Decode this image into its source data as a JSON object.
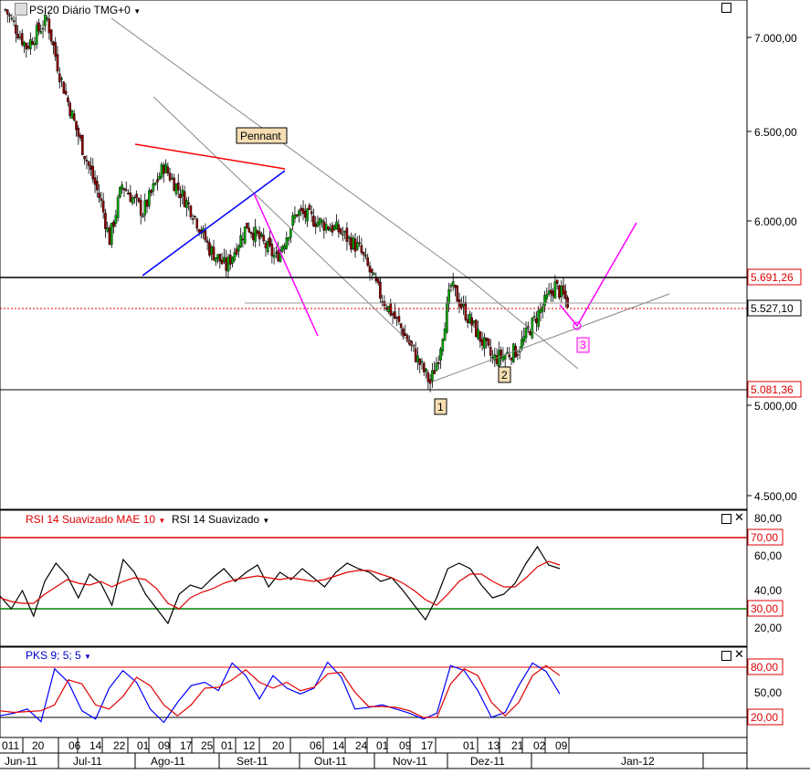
{
  "header": {
    "symbol": "PSI20",
    "period": "Diário",
    "timezone": "TMG+0",
    "dropdown_icon": "caret-down-icon"
  },
  "price_axis": {
    "ticks": [
      "7.000,00",
      "6.500,00",
      "6.000,00",
      "5.000,00",
      "4.500,00"
    ],
    "markers": {
      "resistance": "5.691,26",
      "last": "5.527,10",
      "support": "5.081,36"
    }
  },
  "annotations": {
    "pennant": "Pennant",
    "wave1": "1",
    "wave2": "2",
    "wave3": "3"
  },
  "rsi_panel": {
    "title_smoothed_mae": "RSI 14 Suavizado MAE 10",
    "title_smoothed": "RSI 14 Suavizado",
    "ticks": [
      "80,00",
      "60,00",
      "40,00",
      "20,00"
    ],
    "levels": {
      "upper": "70,00",
      "lower": "30,00"
    }
  },
  "pks_panel": {
    "title": "PKS 9; 5; 5",
    "levels": {
      "upper": "80,00",
      "mid": "50,00",
      "lower": "20,00"
    }
  },
  "time_axis": {
    "day_labels": [
      "011",
      "20",
      "06",
      "14",
      "22",
      "01",
      "09",
      "17",
      "25",
      "01",
      "12",
      "20",
      "06",
      "14",
      "24",
      "01",
      "09",
      "17",
      "01",
      "13",
      "21",
      "02",
      "09"
    ],
    "month_labels": [
      "Jun-11",
      "Jul-11",
      "Ago-11",
      "Set-11",
      "Out-11",
      "Nov-11",
      "Dez-11",
      "Jan-12"
    ]
  },
  "colors": {
    "bull": "#00aa00",
    "bear": "#8b0000",
    "rsi": "#000000",
    "rsi_mae": "#e00000",
    "pks_fast": "#0000ff",
    "pks_slow": "#e00000",
    "projection": "#ff00ff",
    "upper_level": "#e00000",
    "lower_level": "#008000"
  },
  "chart_data": [
    {
      "type": "candlestick",
      "title": "PSI20 Diário",
      "y_range": [
        4400,
        7200
      ],
      "sample_close_path": [
        [
          0,
          7150
        ],
        [
          10,
          6950
        ],
        [
          20,
          7100
        ],
        [
          26,
          6800
        ],
        [
          34,
          6500
        ],
        [
          40,
          6300
        ],
        [
          46,
          6100
        ],
        [
          50,
          5900
        ],
        [
          56,
          6200
        ],
        [
          66,
          6050
        ],
        [
          76,
          6300
        ],
        [
          90,
          6050
        ],
        [
          98,
          5850
        ],
        [
          106,
          5750
        ],
        [
          116,
          5980
        ],
        [
          130,
          5800
        ],
        [
          140,
          6050
        ],
        [
          160,
          5950
        ],
        [
          170,
          5850
        ],
        [
          180,
          5600
        ],
        [
          190,
          5420
        ],
        [
          196,
          5290
        ],
        [
          204,
          5120
        ],
        [
          208,
          5270
        ],
        [
          214,
          5650
        ],
        [
          222,
          5480
        ],
        [
          234,
          5250
        ],
        [
          246,
          5300
        ],
        [
          256,
          5500
        ],
        [
          264,
          5650
        ],
        [
          270,
          5560
        ]
      ],
      "horizontal_levels": {
        "resistance": 5691.26,
        "last": 5527.1,
        "support": 5081.36
      },
      "wave_points": {
        "1": 5081.36,
        "2": 5240,
        "3": 5400
      }
    },
    {
      "type": "line",
      "title": "RSI 14 Suavizado",
      "y_range": [
        10,
        85
      ],
      "levels": [
        70,
        30
      ],
      "series": [
        {
          "name": "RSI 14 Suavizado",
          "values": [
            37,
            30,
            40,
            26,
            45,
            55,
            48,
            36,
            49,
            44,
            32,
            57,
            50,
            38,
            30,
            22,
            38,
            43,
            41,
            47,
            52,
            45,
            50,
            54,
            42,
            50,
            46,
            52,
            47,
            42,
            50,
            55,
            52,
            50,
            45,
            47,
            40,
            32,
            24,
            36,
            52,
            55,
            52,
            43,
            36,
            38,
            44,
            55,
            64,
            54,
            52
          ]
        },
        {
          "name": "RSI 14 Suavizado MAE 10",
          "values": [
            36,
            34,
            33,
            33,
            38,
            42,
            46,
            44,
            43,
            45,
            42,
            45,
            47,
            46,
            41,
            33,
            30,
            36,
            39,
            41,
            44,
            46,
            47,
            48,
            47,
            46,
            47,
            46,
            45,
            46,
            48,
            50,
            51,
            51,
            49,
            47,
            44,
            40,
            35,
            32,
            38,
            45,
            49,
            49,
            45,
            42,
            42,
            47,
            53,
            56,
            54
          ]
        }
      ]
    },
    {
      "type": "line",
      "title": "PKS 9; 5; 5",
      "y_range": [
        5,
        95
      ],
      "levels": [
        80,
        50,
        20
      ],
      "series": [
        {
          "name": "PKS fast",
          "values": [
            22,
            25,
            30,
            15,
            78,
            62,
            28,
            18,
            55,
            76,
            62,
            30,
            14,
            38,
            58,
            62,
            52,
            85,
            70,
            42,
            70,
            55,
            48,
            55,
            86,
            68,
            30,
            32,
            35,
            30,
            25,
            18,
            25,
            82,
            76,
            52,
            20,
            26,
            58,
            85,
            75,
            48
          ]
        },
        {
          "name": "PKS slow",
          "values": [
            28,
            26,
            27,
            28,
            35,
            65,
            60,
            35,
            30,
            45,
            68,
            58,
            35,
            22,
            35,
            55,
            56,
            65,
            77,
            62,
            55,
            62,
            52,
            56,
            72,
            74,
            50,
            33,
            33,
            32,
            28,
            20,
            20,
            60,
            78,
            70,
            38,
            22,
            38,
            70,
            82,
            70
          ]
        }
      ]
    }
  ]
}
